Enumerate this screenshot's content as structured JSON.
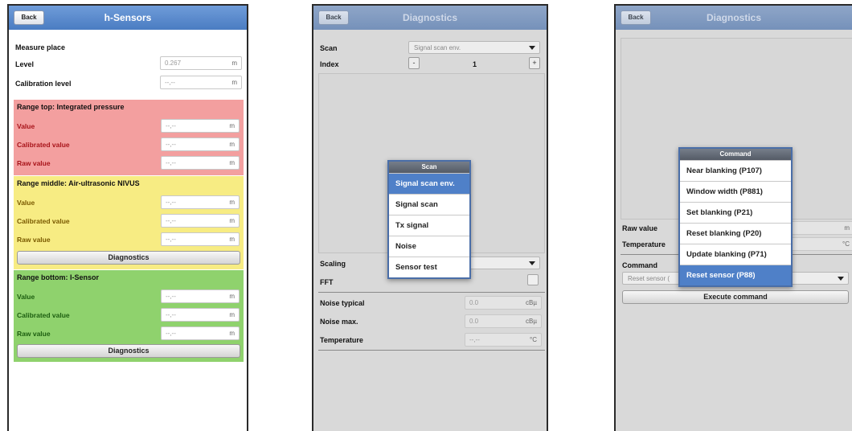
{
  "screen1": {
    "back": "Back",
    "title": "h-Sensors",
    "measure_place": "Measure place",
    "level_label": "Level",
    "level_value": "0.267",
    "level_unit": "m",
    "calibration_label": "Calibration level",
    "calibration_value": "--,--",
    "calibration_unit": "m",
    "sections": [
      {
        "title": "Range top: Integrated pressure",
        "color": "#f39f9f",
        "rows": [
          {
            "label": "Value",
            "value": "--,--",
            "unit": "m"
          },
          {
            "label": "Calibrated value",
            "value": "--,--",
            "unit": "m"
          },
          {
            "label": "Raw value",
            "value": "--,--",
            "unit": "m"
          }
        ]
      },
      {
        "title": "Range middle: Air-ultrasonic NIVUS",
        "color": "#f7ec83",
        "rows": [
          {
            "label": "Value",
            "value": "--,--",
            "unit": "m"
          },
          {
            "label": "Calibrated value",
            "value": "--,--",
            "unit": "m"
          },
          {
            "label": "Raw value",
            "value": "--,--",
            "unit": "m"
          }
        ],
        "button": "Diagnostics"
      },
      {
        "title": "Range bottom: I-Sensor",
        "color": "#8fd26d",
        "rows": [
          {
            "label": "Value",
            "value": "--,--",
            "unit": "m"
          },
          {
            "label": "Calibrated value",
            "value": "--,--",
            "unit": "m"
          },
          {
            "label": "Raw value",
            "value": "--,--",
            "unit": "m"
          }
        ],
        "button": "Diagnostics"
      }
    ]
  },
  "screen2": {
    "back": "Back",
    "title": "Diagnostics",
    "scan_label": "Scan",
    "scan_value": "Signal scan env.",
    "index_label": "Index",
    "index_minus": "-",
    "index_value": "1",
    "index_plus": "+",
    "scaling_label": "Scaling",
    "fft_label": "FFT",
    "noise_typical_label": "Noise typical",
    "noise_typical_value": "0.0",
    "noise_typical_unit": "cBµ",
    "noise_max_label": "Noise max.",
    "noise_max_value": "0.0",
    "noise_max_unit": "cBµ",
    "temperature_label": "Temperature",
    "temperature_value": "--,--",
    "temperature_unit": "°C",
    "popup": {
      "title": "Scan",
      "items": [
        "Signal scan env.",
        "Signal scan",
        "Tx signal",
        "Noise",
        "Sensor test"
      ],
      "selected": "Signal scan env."
    }
  },
  "screen3": {
    "back": "Back",
    "title": "Diagnostics",
    "raw_value_label": "Raw value",
    "raw_value_unit": "m",
    "temperature_label": "Temperature",
    "temperature_unit": "°C",
    "command_label": "Command",
    "command_value": "Reset sensor (",
    "execute": "Execute command",
    "popup": {
      "title": "Command",
      "items": [
        "Near blanking (P107)",
        "Window width (P881)",
        "Set blanking (P21)",
        "Reset blanking (P20)",
        "Update blanking (P71)",
        "Reset sensor (P88)"
      ],
      "selected": "Reset sensor (P88)"
    }
  }
}
